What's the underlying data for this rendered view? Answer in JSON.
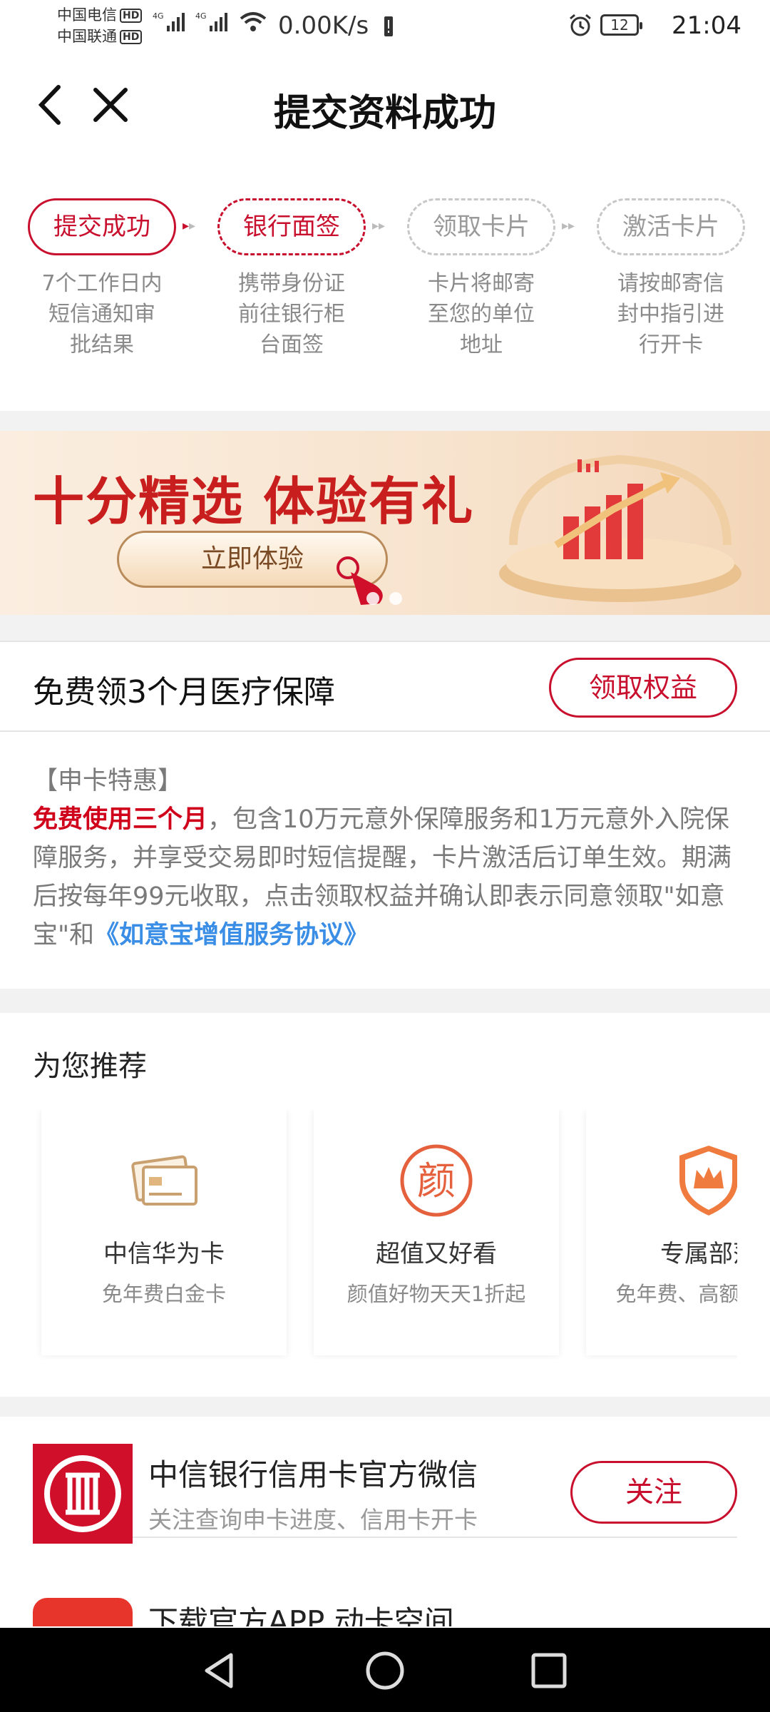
{
  "status_bar": {
    "carrier1": "中国电信",
    "carrier2": "中国联通",
    "hd": "HD",
    "speed": "0.00K/s",
    "battery": "12",
    "time": "21:04"
  },
  "header": {
    "title": "提交资料成功",
    "icons": [
      "back-icon",
      "close-icon"
    ]
  },
  "steps": [
    {
      "label": "提交成功",
      "desc": [
        "7个工作日内",
        "短信通知审",
        "批结果"
      ],
      "state": "done"
    },
    {
      "label": "银行面签",
      "desc": [
        "携带身份证",
        "前往银行柜",
        "台面签"
      ],
      "state": "current"
    },
    {
      "label": "领取卡片",
      "desc": [
        "卡片将邮寄",
        "至您的单位",
        "地址"
      ],
      "state": "pending"
    },
    {
      "label": "激活卡片",
      "desc": [
        "请按邮寄信",
        "封中指引进",
        "行开卡"
      ],
      "state": "pending"
    }
  ],
  "banner": {
    "title": "十分精选  体验有礼",
    "button": "立即体验"
  },
  "benefit": {
    "title": "免费领3个月医疗保障",
    "button": "领取权益",
    "tag": "【申卡特惠】",
    "highlight": "免费使用三个月",
    "body": "，包含10万元意外保障服务和1万元意外入院保障服务，并享受交易即时短信提醒，卡片激活后订单生效。期满后按每年99元收取，点击领取权益并确认即表示同意领取\"如意宝\"和",
    "link": "《如意宝增值服务协议》"
  },
  "recommend": {
    "title": "为您推荐",
    "cards": [
      {
        "name": "中信华为卡",
        "sub": "免年费白金卡",
        "icon": "card-icon"
      },
      {
        "name": "超值又好看",
        "sub": "颜值好物天天1折起",
        "icon": "yan-icon",
        "icon_text": "颜"
      },
      {
        "name": "专属部落",
        "sub": "免年费、高额享好礼",
        "icon": "shield-crown-icon"
      }
    ]
  },
  "wechat": {
    "title": "中信银行信用卡官方微信",
    "sub": "关注查询申卡进度、信用卡开卡",
    "button": "关注"
  },
  "app": {
    "title": "下载官方APP 动卡空间"
  },
  "colors": {
    "accent": "#c8102e",
    "link": "#3a8ee6"
  }
}
